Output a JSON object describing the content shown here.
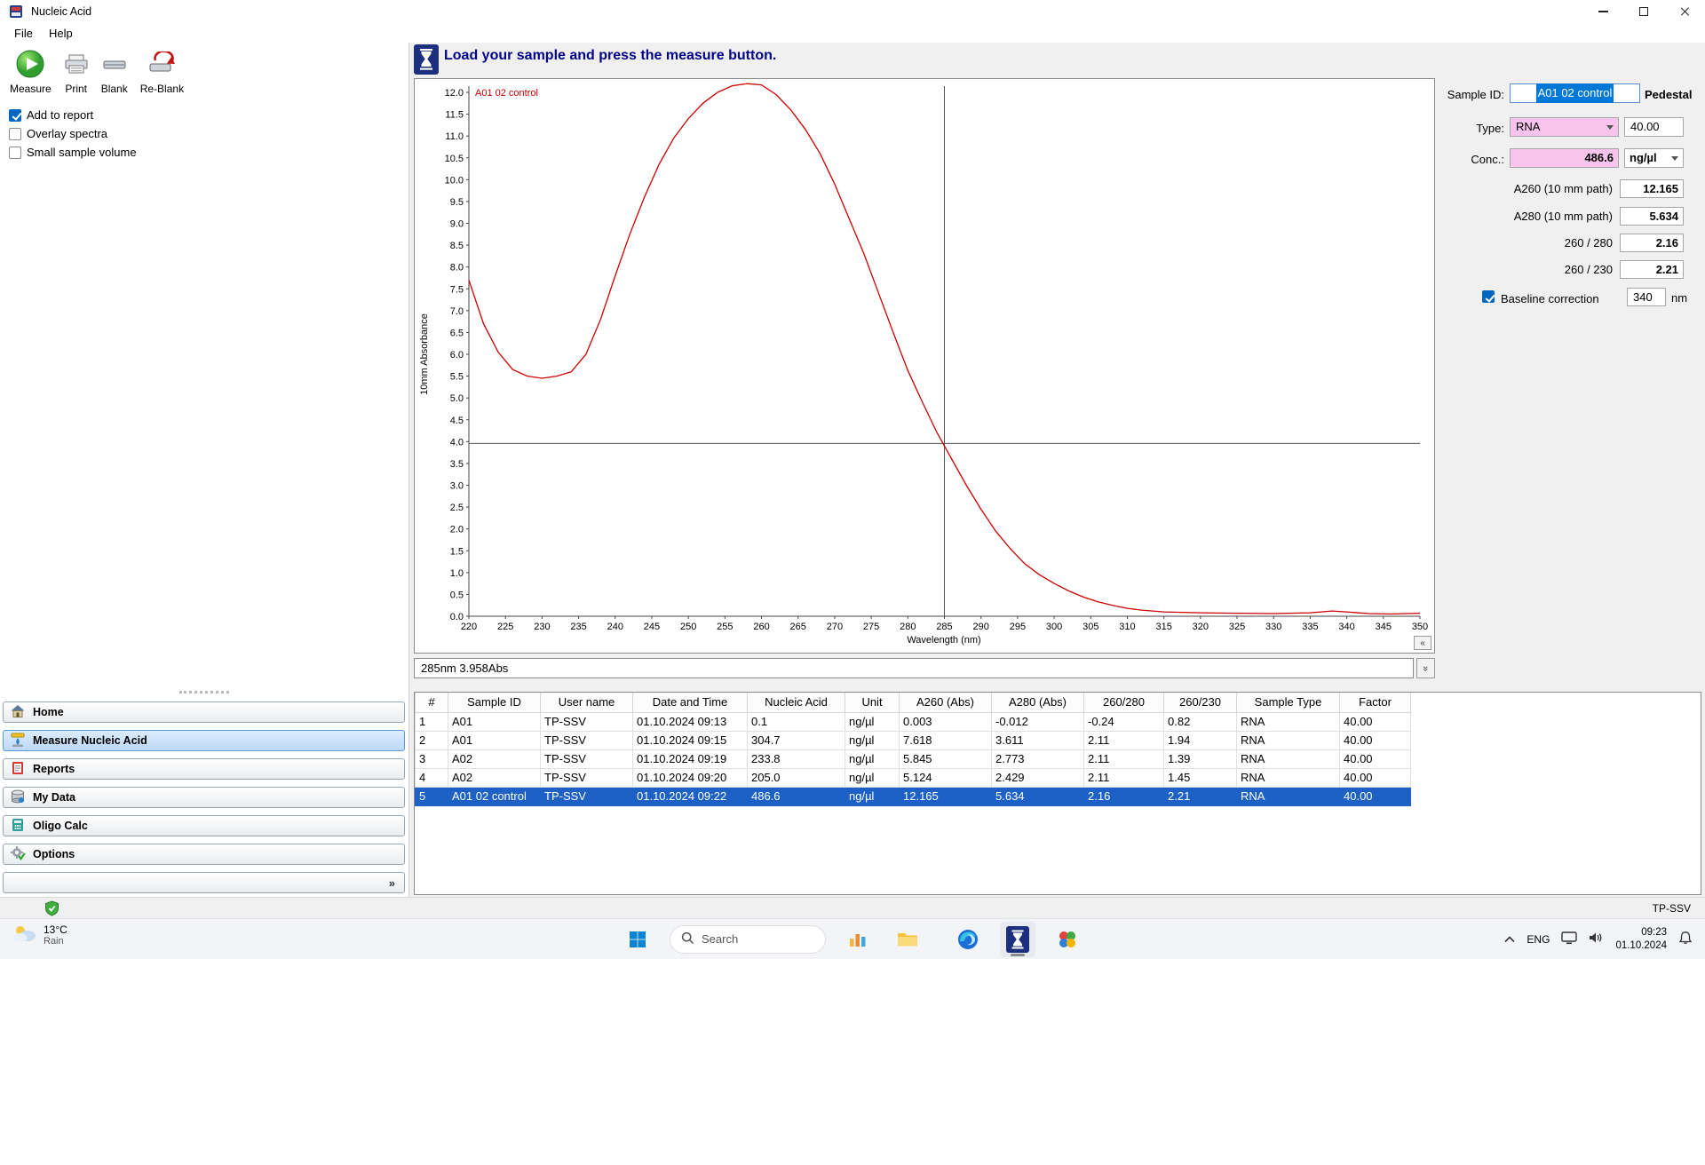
{
  "window": {
    "title": "Nucleic Acid",
    "menu": [
      "File",
      "Help"
    ]
  },
  "toolbar": {
    "buttons": [
      {
        "label": "Measure"
      },
      {
        "label": "Print"
      },
      {
        "label": "Blank"
      },
      {
        "label": "Re-Blank"
      }
    ],
    "checkboxes": [
      {
        "label": "Add to report",
        "checked": true
      },
      {
        "label": "Overlay spectra",
        "checked": false
      },
      {
        "label": "Small sample volume",
        "checked": false
      }
    ]
  },
  "sidebar": {
    "items": [
      {
        "label": "Home",
        "selected": false
      },
      {
        "label": "Measure Nucleic Acid",
        "selected": true
      },
      {
        "label": "Reports",
        "selected": false
      },
      {
        "label": "My Data",
        "selected": false
      },
      {
        "label": "Oligo Calc",
        "selected": false
      },
      {
        "label": "Options",
        "selected": false
      }
    ],
    "collapse_glyph": "»"
  },
  "message_bar": {
    "text": "Load your sample and press the measure button."
  },
  "glyphs": {
    "chart_collapse": "«",
    "readout_collapse": "»"
  },
  "chart_data": {
    "type": "line",
    "series_label": "A01 02 control",
    "xlabel": "Wavelength (nm)",
    "ylabel": "10mm Absorbance",
    "xlim": [
      220,
      350
    ],
    "xstep": 5,
    "ylim": [
      0,
      12
    ],
    "ystep": 0.5,
    "grid": false,
    "line_color": "#cc0000",
    "crosshair": {
      "x": 285,
      "y": 3.958
    },
    "x": [
      220,
      222,
      224,
      226,
      228,
      230,
      232,
      234,
      236,
      238,
      240,
      242,
      244,
      246,
      248,
      250,
      252,
      254,
      256,
      258,
      260,
      262,
      264,
      266,
      268,
      270,
      272,
      274,
      276,
      278,
      280,
      282,
      284,
      286,
      288,
      290,
      292,
      294,
      296,
      298,
      300,
      302,
      304,
      306,
      308,
      310,
      312,
      315,
      320,
      325,
      330,
      335,
      338,
      340,
      343,
      346,
      350
    ],
    "y": [
      7.7,
      6.7,
      6.05,
      5.65,
      5.5,
      5.45,
      5.5,
      5.6,
      6.0,
      6.8,
      7.8,
      8.75,
      9.6,
      10.35,
      10.95,
      11.4,
      11.75,
      12.0,
      12.15,
      12.2,
      12.17,
      11.95,
      11.6,
      11.15,
      10.6,
      9.9,
      9.1,
      8.3,
      7.4,
      6.5,
      5.63,
      4.9,
      4.2,
      3.6,
      3.0,
      2.45,
      1.95,
      1.55,
      1.2,
      0.95,
      0.75,
      0.58,
      0.44,
      0.33,
      0.25,
      0.18,
      0.14,
      0.1,
      0.08,
      0.07,
      0.06,
      0.08,
      0.12,
      0.1,
      0.06,
      0.05,
      0.07
    ]
  },
  "status_readout": {
    "text": "285nm 3.958Abs"
  },
  "side_panel": {
    "sample_id_label": "Sample ID:",
    "sample_id_value": "A01 02 control",
    "pedestal_label": "Pedestal",
    "type_label": "Type:",
    "type_value": "RNA",
    "factor_value": "40.00",
    "conc_label": "Conc.:",
    "conc_value": "486.6",
    "conc_unit": "ng/µl",
    "rows": [
      {
        "label": "A260 (10 mm path)",
        "value": "12.165"
      },
      {
        "label": "A280 (10 mm path)",
        "value": "5.634"
      },
      {
        "label": "260 / 280",
        "value": "2.16"
      },
      {
        "label": "260 / 230",
        "value": "2.21"
      }
    ],
    "baseline": {
      "label": "Baseline correction",
      "checked": true,
      "value": "340",
      "unit": "nm"
    }
  },
  "results_table": {
    "columns": [
      "#",
      "Sample ID",
      "User name",
      "Date and Time",
      "Nucleic Acid",
      "Unit",
      "A260 (Abs)",
      "A280 (Abs)",
      "260/280",
      "260/230",
      "Sample Type",
      "Factor"
    ],
    "rows": [
      [
        "1",
        "A01",
        "TP-SSV",
        "01.10.2024 09:13",
        "0.1",
        "ng/µl",
        "0.003",
        "-0.012",
        "-0.24",
        "0.82",
        "RNA",
        "40.00"
      ],
      [
        "2",
        "A01",
        "TP-SSV",
        "01.10.2024 09:15",
        "304.7",
        "ng/µl",
        "7.618",
        "3.611",
        "2.11",
        "1.94",
        "RNA",
        "40.00"
      ],
      [
        "3",
        "A02",
        "TP-SSV",
        "01.10.2024 09:19",
        "233.8",
        "ng/µl",
        "5.845",
        "2.773",
        "2.11",
        "1.39",
        "RNA",
        "40.00"
      ],
      [
        "4",
        "A02",
        "TP-SSV",
        "01.10.2024 09:20",
        "205.0",
        "ng/µl",
        "5.124",
        "2.429",
        "2.11",
        "1.45",
        "RNA",
        "40.00"
      ],
      [
        "5",
        "A01 02 control",
        "TP-SSV",
        "01.10.2024 09:22",
        "486.6",
        "ng/µl",
        "12.165",
        "5.634",
        "2.16",
        "2.21",
        "RNA",
        "40.00"
      ]
    ],
    "selected_row": 4
  },
  "statusbar": {
    "user": "TP-SSV"
  },
  "taskbar": {
    "weather": {
      "temp": "13°C",
      "condition": "Rain"
    },
    "search_placeholder": "Search",
    "tray": {
      "lang": "ENG",
      "time": "09:23",
      "date": "01.10.2024"
    }
  },
  "colors": {
    "selection_blue": "#1d60c6",
    "input_pink": "#f8c3ec",
    "curve_red": "#cc0000",
    "message_navy": "#00008b"
  }
}
